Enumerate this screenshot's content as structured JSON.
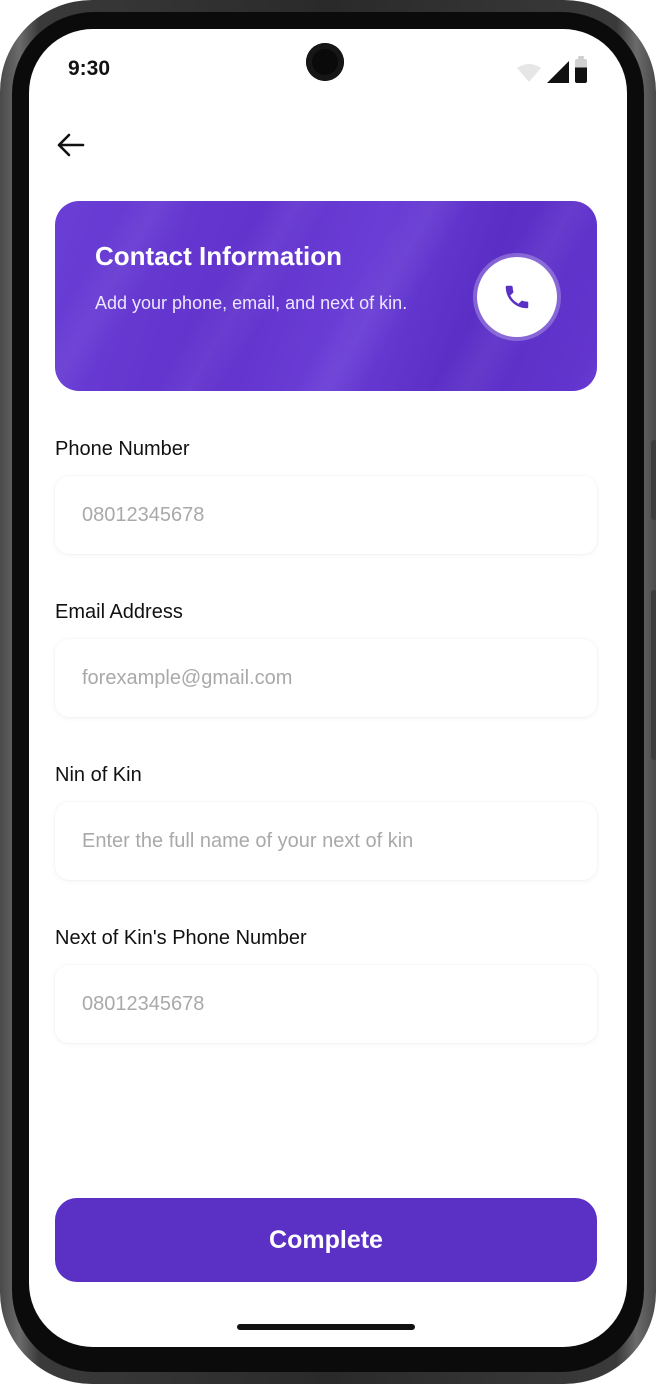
{
  "status_bar": {
    "time": "9:30",
    "icons": [
      "wifi-icon",
      "signal-icon",
      "battery-icon"
    ]
  },
  "header": {
    "back_icon": "arrow-left-icon"
  },
  "banner": {
    "title": "Contact Information",
    "subtitle": "Add your phone, email, and next of kin.",
    "icon": "phone-icon",
    "color": "#6233cd"
  },
  "form": {
    "fields": [
      {
        "label": "Phone Number",
        "placeholder": "08012345678",
        "value": ""
      },
      {
        "label": "Email Address",
        "placeholder": "forexample@gmail.com",
        "value": ""
      },
      {
        "label": "Nin of Kin",
        "placeholder": "Enter the full name of your next of kin",
        "value": ""
      },
      {
        "label": "Next of Kin's Phone Number",
        "placeholder": "08012345678",
        "value": ""
      }
    ]
  },
  "actions": {
    "complete_label": "Complete",
    "accent_color": "#5a30c5"
  }
}
